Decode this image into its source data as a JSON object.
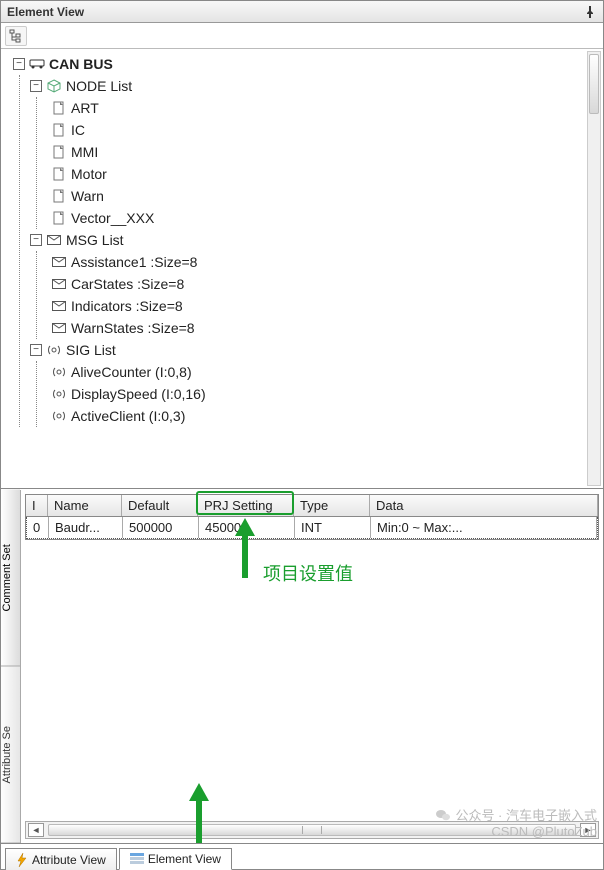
{
  "window": {
    "title": "Element View"
  },
  "tree": {
    "root": {
      "label": "CAN BUS"
    },
    "node_list": {
      "label": "NODE List",
      "items": [
        "ART",
        "IC",
        "MMI",
        "Motor",
        "Warn",
        "Vector__XXX"
      ]
    },
    "msg_list": {
      "label": "MSG List",
      "items": [
        "Assistance1  :Size=8",
        "CarStates  :Size=8",
        "Indicators  :Size=8",
        "WarnStates  :Size=8"
      ]
    },
    "sig_list": {
      "label": "SIG List",
      "items": [
        "AliveCounter (I:0,8)",
        "DisplaySpeed (I:0,16)",
        "ActiveClient (I:0,3)"
      ]
    }
  },
  "vtabs": {
    "comment": "Comment Set",
    "attribute": "Attribute Se"
  },
  "grid": {
    "headers": {
      "idx": "I",
      "name": "Name",
      "def": "Default",
      "prj": "PRJ Setting",
      "type": "Type",
      "data": "Data"
    },
    "row": {
      "idx": "0",
      "name": "Baudr...",
      "def": "500000",
      "prj": "450000",
      "type": "INT",
      "data": "Min:0 ~ Max:..."
    }
  },
  "annotation": {
    "label": "项目设置值"
  },
  "bottom_tabs": {
    "attr": "Attribute View",
    "elem": "Element View"
  },
  "watermark": {
    "line1": "公众号 · 汽车电子嵌入式",
    "line2": "CSDN @PlutoZub"
  }
}
